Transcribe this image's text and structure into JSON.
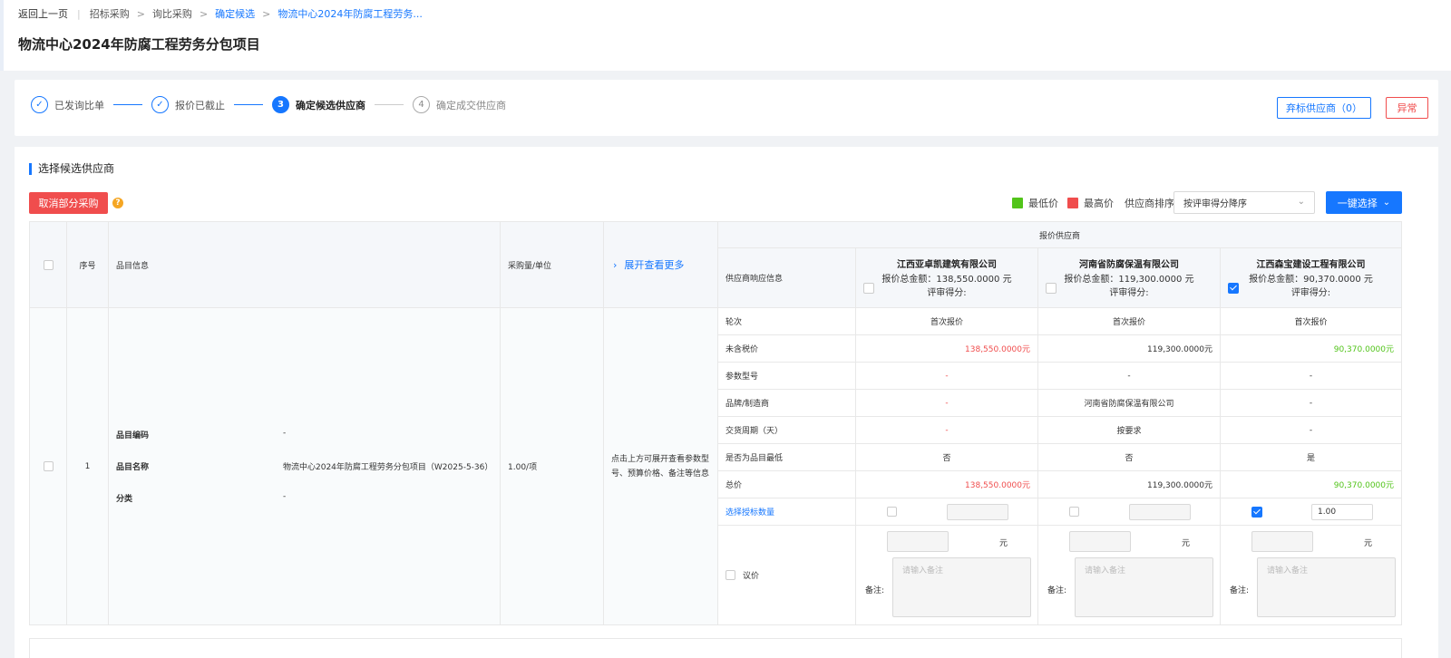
{
  "breadcrumb": {
    "back": "返回上一页",
    "items": [
      "招标采购",
      "询比采购",
      "确定候选",
      "物流中心2024年防腐工程劳务..."
    ]
  },
  "page_title": "物流中心2024年防腐工程劳务分包项目",
  "steps": [
    {
      "num": "1",
      "label": "已发询比单",
      "state": "done"
    },
    {
      "num": "2",
      "label": "报价已截止",
      "state": "done"
    },
    {
      "num": "3",
      "label": "确定候选供应商",
      "state": "active"
    },
    {
      "num": "4",
      "label": "确定成交供应商",
      "state": "todo"
    }
  ],
  "header_buttons": {
    "abandon": "弃标供应商（0）",
    "abnormal": "异常"
  },
  "section_title": "选择候选供应商",
  "toolbar": {
    "cancel_partial": "取消部分采购",
    "help": "?",
    "legend_low": "最低价",
    "legend_high": "最高价",
    "sort_label": "供应商排序",
    "sort_value": "按评审得分降序",
    "one_click": "一键选择"
  },
  "colors": {
    "low": "#52c41a",
    "high": "#f04d4d",
    "accent": "#1677ff"
  },
  "table": {
    "headers": {
      "index": "序号",
      "item_info": "品目信息",
      "qty_unit": "采购量/单位",
      "expand": "展开查看更多",
      "quote_suppliers": "报价供应商",
      "supplier_response": "供应商响应信息"
    },
    "row": {
      "index": "1",
      "fields": [
        {
          "label": "品目编码",
          "value": "-"
        },
        {
          "label": "品目名称",
          "value": "物流中心2024年防腐工程劳务分包项目（W2025-5-36）"
        },
        {
          "label": "分类",
          "value": "-"
        }
      ],
      "qty": "1.00/项",
      "expand_hint": "点击上方可展开查看参数型号、预算价格、备注等信息"
    },
    "response_labels": [
      "轮次",
      "未含税价",
      "参数型号",
      "品牌/制造商",
      "交货周期（天）",
      "是否为品目最低",
      "总价",
      "选择授标数量",
      "议价"
    ],
    "remark_label": "备注:",
    "yuan": "元",
    "remark_placeholder": "请输入备注",
    "suppliers": [
      {
        "name": "江西亚卓凯建筑有限公司",
        "total_line": "报价总金额：138,550.0000 元",
        "score_line": "评审得分:",
        "checked": false,
        "round": "首次报价",
        "pretax": "138,550.0000元",
        "pretax_color": "high",
        "model": "-",
        "brand": "-",
        "delivery": "-",
        "is_lowest": "否",
        "total": "138,550.0000元",
        "total_color": "high",
        "award_checked": false,
        "award_qty": ""
      },
      {
        "name": "河南省防腐保温有限公司",
        "total_line": "报价总金额：119,300.0000 元",
        "score_line": "评审得分:",
        "checked": false,
        "round": "首次报价",
        "pretax": "119,300.0000元",
        "pretax_color": "normal",
        "model": "-",
        "brand": "河南省防腐保温有限公司",
        "delivery": "按要求",
        "is_lowest": "否",
        "total": "119,300.0000元",
        "total_color": "normal",
        "award_checked": false,
        "award_qty": ""
      },
      {
        "name": "江西森宝建设工程有限公司",
        "total_line": "报价总金额：90,370.0000 元",
        "score_line": "评审得分:",
        "checked": true,
        "round": "首次报价",
        "pretax": "90,370.0000元",
        "pretax_color": "low",
        "model": "-",
        "brand": "-",
        "delivery": "-",
        "is_lowest": "是",
        "total": "90,370.0000元",
        "total_color": "low",
        "award_checked": true,
        "award_qty": "1.00"
      }
    ]
  }
}
